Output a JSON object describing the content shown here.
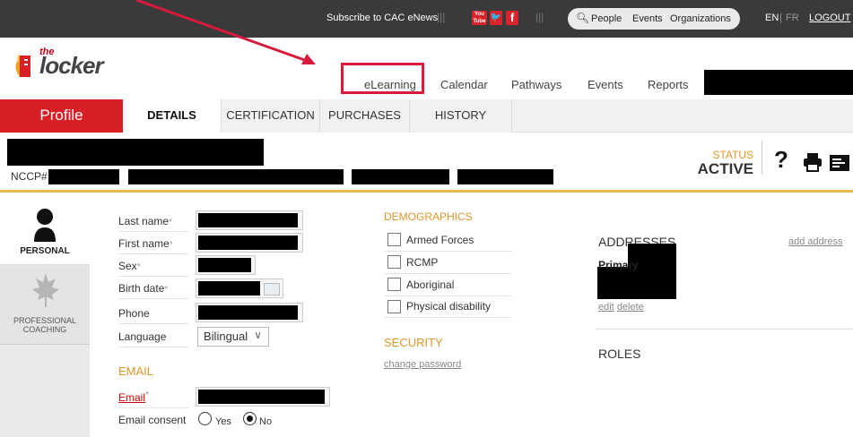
{
  "topbar": {
    "subscribe": "Subscribe to CAC eNews",
    "social": [
      {
        "name": "youtube-icon",
        "text": "You\nTube",
        "color": "#d8232a"
      },
      {
        "name": "twitter-icon",
        "text": "❯",
        "color": "#d8232a"
      },
      {
        "name": "facebook-icon",
        "text": "f",
        "color": "#d8232a"
      }
    ],
    "search_links": [
      "People",
      "Events",
      "Organizations"
    ],
    "lang_en": "EN",
    "lang_fr": "FR",
    "logout": "LOGOUT"
  },
  "logo": {
    "the": "the",
    "locker": "locker"
  },
  "nav": {
    "items": [
      "eLearning",
      "Calendar",
      "Pathways",
      "Events",
      "Reports"
    ]
  },
  "tabs": {
    "profile": "Profile",
    "items": [
      "DETAILS",
      "CERTIFICATION",
      "PURCHASES",
      "HISTORY"
    ],
    "active": "DETAILS"
  },
  "identity": {
    "nccp_label": "NCCP#",
    "status_label": "STATUS",
    "status_value": "ACTIVE",
    "help": "?"
  },
  "sidebar": {
    "personal": "PERSONAL",
    "professional_line1": "PROFESSIONAL",
    "professional_line2": "COACHING"
  },
  "form": {
    "last_name": "Last name",
    "first_name": "First name",
    "sex": "Sex",
    "birth_date": "Birth date",
    "phone": "Phone",
    "language": "Language",
    "language_value": "Bilingual",
    "required_mark": "*",
    "email_section": "EMAIL",
    "email_label": "Email",
    "email_consent": "Email consent",
    "yes": "Yes",
    "no": "No"
  },
  "demographics": {
    "heading": "DEMOGRAPHICS",
    "items": [
      "Armed Forces",
      "RCMP",
      "Aboriginal",
      "Physical disability"
    ],
    "security_heading": "SECURITY",
    "change_password": "change password"
  },
  "addresses": {
    "heading": "ADDRESSES",
    "add": "add address",
    "primary": "Primary",
    "edit": "edit",
    "delete": "delete",
    "roles": "ROLES"
  },
  "colors": {
    "brand_red": "#d91f26",
    "accent_orange": "#e0962b",
    "highlight": "#d81b3c"
  }
}
